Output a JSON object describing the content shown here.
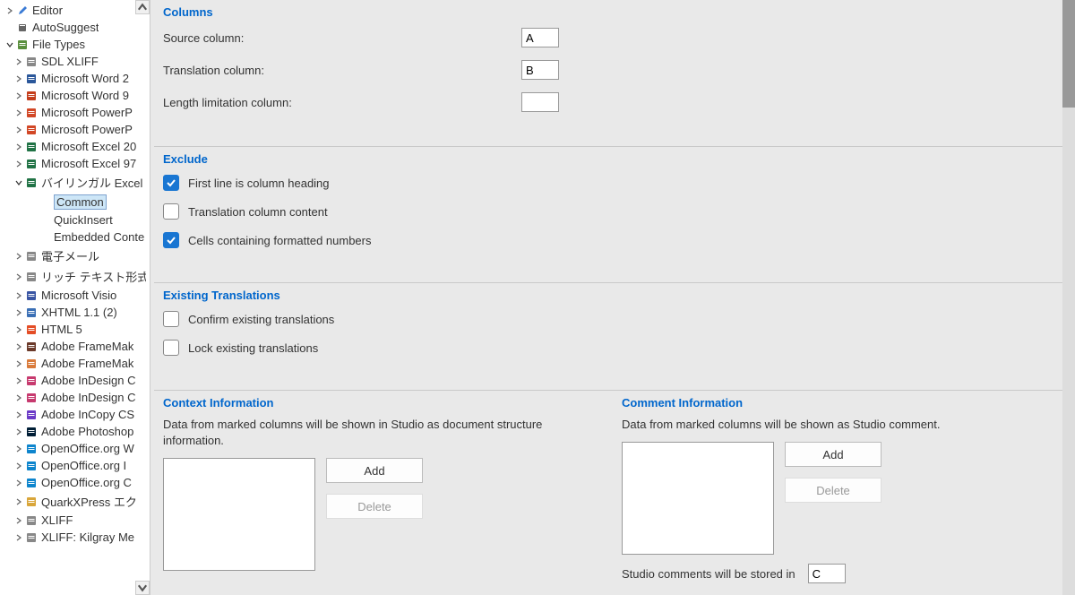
{
  "sidebar": {
    "items": [
      {
        "icon": "pencil",
        "color": "#3a7bd5",
        "label": "Editor",
        "expand": "closed",
        "indent": 0
      },
      {
        "icon": "book",
        "color": "#666",
        "label": "AutoSuggest",
        "expand": "none",
        "indent": 0
      },
      {
        "icon": "doc",
        "color": "#5a8f3d",
        "label": "File Types",
        "expand": "open",
        "indent": 0
      },
      {
        "icon": "doc",
        "color": "#888",
        "label": "SDL XLIFF",
        "expand": "closed",
        "indent": 1
      },
      {
        "icon": "word",
        "color": "#2b579a",
        "label": "Microsoft Word 2",
        "expand": "closed",
        "indent": 1
      },
      {
        "icon": "word",
        "color": "#c43e1c",
        "label": "Microsoft Word 9",
        "expand": "closed",
        "indent": 1
      },
      {
        "icon": "ppt",
        "color": "#d24726",
        "label": "Microsoft PowerP",
        "expand": "closed",
        "indent": 1
      },
      {
        "icon": "ppt",
        "color": "#d24726",
        "label": "Microsoft PowerP",
        "expand": "closed",
        "indent": 1
      },
      {
        "icon": "excel",
        "color": "#217346",
        "label": "Microsoft Excel 20",
        "expand": "closed",
        "indent": 1
      },
      {
        "icon": "excel",
        "color": "#217346",
        "label": "Microsoft Excel 97",
        "expand": "closed",
        "indent": 1
      },
      {
        "icon": "excel",
        "color": "#217346",
        "label": "バイリンガル Excel",
        "expand": "open",
        "indent": 1
      },
      {
        "icon": "none",
        "color": "",
        "label": "Common",
        "expand": "none",
        "indent": 2,
        "selected": true
      },
      {
        "icon": "none",
        "color": "",
        "label": "QuickInsert",
        "expand": "none",
        "indent": 2
      },
      {
        "icon": "none",
        "color": "",
        "label": "Embedded Conte",
        "expand": "none",
        "indent": 2
      },
      {
        "icon": "mail",
        "color": "#888",
        "label": "電子メール",
        "expand": "closed",
        "indent": 1
      },
      {
        "icon": "rtf",
        "color": "#888",
        "label": "リッチ テキスト形式",
        "expand": "closed",
        "indent": 1
      },
      {
        "icon": "visio",
        "color": "#3955a3",
        "label": "Microsoft Visio",
        "expand": "closed",
        "indent": 1
      },
      {
        "icon": "xml",
        "color": "#3a6fb5",
        "label": "XHTML 1.1 (2)",
        "expand": "closed",
        "indent": 1
      },
      {
        "icon": "html",
        "color": "#e44d26",
        "label": "HTML 5",
        "expand": "closed",
        "indent": 1
      },
      {
        "icon": "fm",
        "color": "#6b3a2a",
        "label": "Adobe FrameMak",
        "expand": "closed",
        "indent": 1
      },
      {
        "icon": "fm",
        "color": "#d97a3a",
        "label": "Adobe FrameMak",
        "expand": "closed",
        "indent": 1
      },
      {
        "icon": "id",
        "color": "#c73a6f",
        "label": "Adobe InDesign C",
        "expand": "closed",
        "indent": 1
      },
      {
        "icon": "id",
        "color": "#c73a6f",
        "label": "Adobe InDesign C",
        "expand": "closed",
        "indent": 1
      },
      {
        "icon": "ic",
        "color": "#6b3ac7",
        "label": "Adobe InCopy CS",
        "expand": "closed",
        "indent": 1
      },
      {
        "icon": "ps",
        "color": "#001e36",
        "label": "Adobe Photoshop",
        "expand": "closed",
        "indent": 1
      },
      {
        "icon": "oo",
        "color": "#0e85cd",
        "label": "OpenOffice.org W",
        "expand": "closed",
        "indent": 1
      },
      {
        "icon": "oo",
        "color": "#0e85cd",
        "label": "OpenOffice.org I",
        "expand": "closed",
        "indent": 1
      },
      {
        "icon": "oo",
        "color": "#0e85cd",
        "label": "OpenOffice.org C",
        "expand": "closed",
        "indent": 1
      },
      {
        "icon": "qx",
        "color": "#d9a63a",
        "label": "QuarkXPress エク",
        "expand": "closed",
        "indent": 1
      },
      {
        "icon": "xl",
        "color": "#888",
        "label": "XLIFF",
        "expand": "closed",
        "indent": 1
      },
      {
        "icon": "xl",
        "color": "#888",
        "label": "XLIFF: Kilgray Me",
        "expand": "closed",
        "indent": 1
      }
    ]
  },
  "columns": {
    "title": "Columns",
    "source_label": "Source column:",
    "source_value": "A",
    "translation_label": "Translation column:",
    "translation_value": "B",
    "length_label": "Length limitation column:",
    "length_value": ""
  },
  "exclude": {
    "title": "Exclude",
    "opt1": "First line is column heading",
    "opt1_checked": true,
    "opt2": "Translation column content",
    "opt2_checked": false,
    "opt3": "Cells containing formatted numbers",
    "opt3_checked": true
  },
  "existing": {
    "title": "Existing Translations",
    "opt1": "Confirm existing translations",
    "opt1_checked": false,
    "opt2": "Lock existing translations",
    "opt2_checked": false
  },
  "context": {
    "title": "Context Information",
    "desc": "Data from marked columns will be shown in Studio as document structure information.",
    "add": "Add",
    "delete": "Delete"
  },
  "comment": {
    "title": "Comment Information",
    "desc": "Data from marked columns will be shown as Studio comment.",
    "add": "Add",
    "delete": "Delete",
    "footer": "Studio comments will be stored in",
    "footer_value": "C"
  }
}
